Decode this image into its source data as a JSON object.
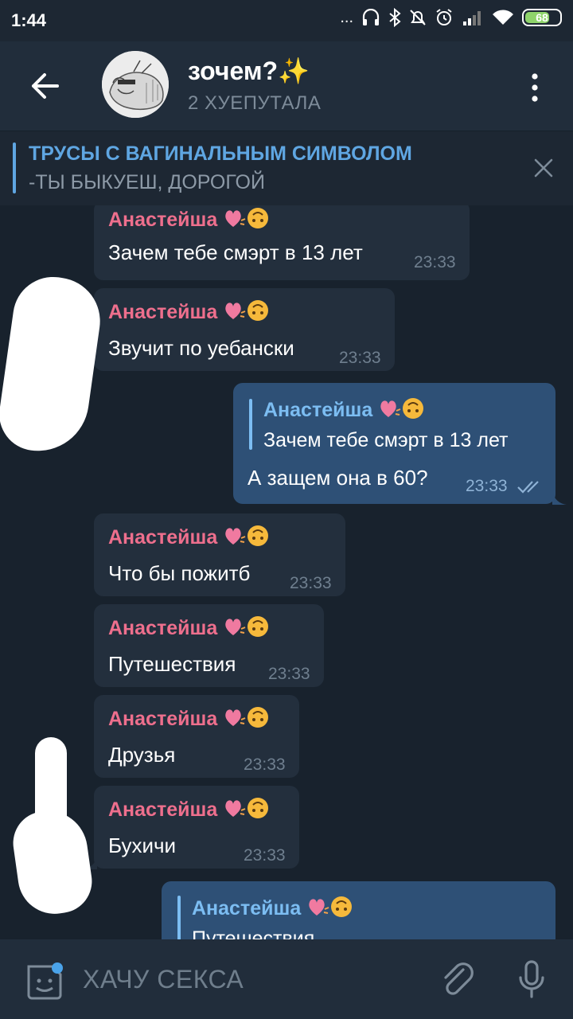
{
  "status_bar": {
    "time": "1:44",
    "icons": "...",
    "battery": "68"
  },
  "header": {
    "title": "зочем?✨",
    "subtitle": "2 ХУЕПУТАЛА"
  },
  "pinned": {
    "title": "ТРУСЫ С ВАГИНАЛЬНЫМ СИМВОЛОМ",
    "text": "-ТЫ БЫКУЕШ, ДОРОГОЙ"
  },
  "messages": [
    {
      "sender": "Анастейша",
      "text": "Зачем тебе смэрт в 13 лет",
      "time": "23:33"
    },
    {
      "sender": "Анастейша",
      "text": "Звучит по уебански",
      "time": "23:33"
    },
    {
      "reply_name": "Анастейша",
      "reply_text": "Зачем тебе смэрт в 13 лет",
      "text": "А защем она в 60?",
      "time": "23:33"
    },
    {
      "sender": "Анастейша",
      "text": "Что бы пожитб",
      "time": "23:33"
    },
    {
      "sender": "Анастейша",
      "text": "Путешествия",
      "time": "23:33"
    },
    {
      "sender": "Анастейша",
      "text": "Друзья",
      "time": "23:33"
    },
    {
      "sender": "Анастейша",
      "text": "Бухичи",
      "time": "23:33"
    },
    {
      "reply_name": "Анастейша",
      "reply_text": "Путешествия"
    }
  ],
  "input": {
    "placeholder": "ХАЧУ СЕКСА"
  },
  "colors": {
    "sender": "#ee6f8d",
    "reply": "#7cbdf2",
    "outgoing_bubble": "#2e5076",
    "incoming_bubble": "#232f3d"
  }
}
